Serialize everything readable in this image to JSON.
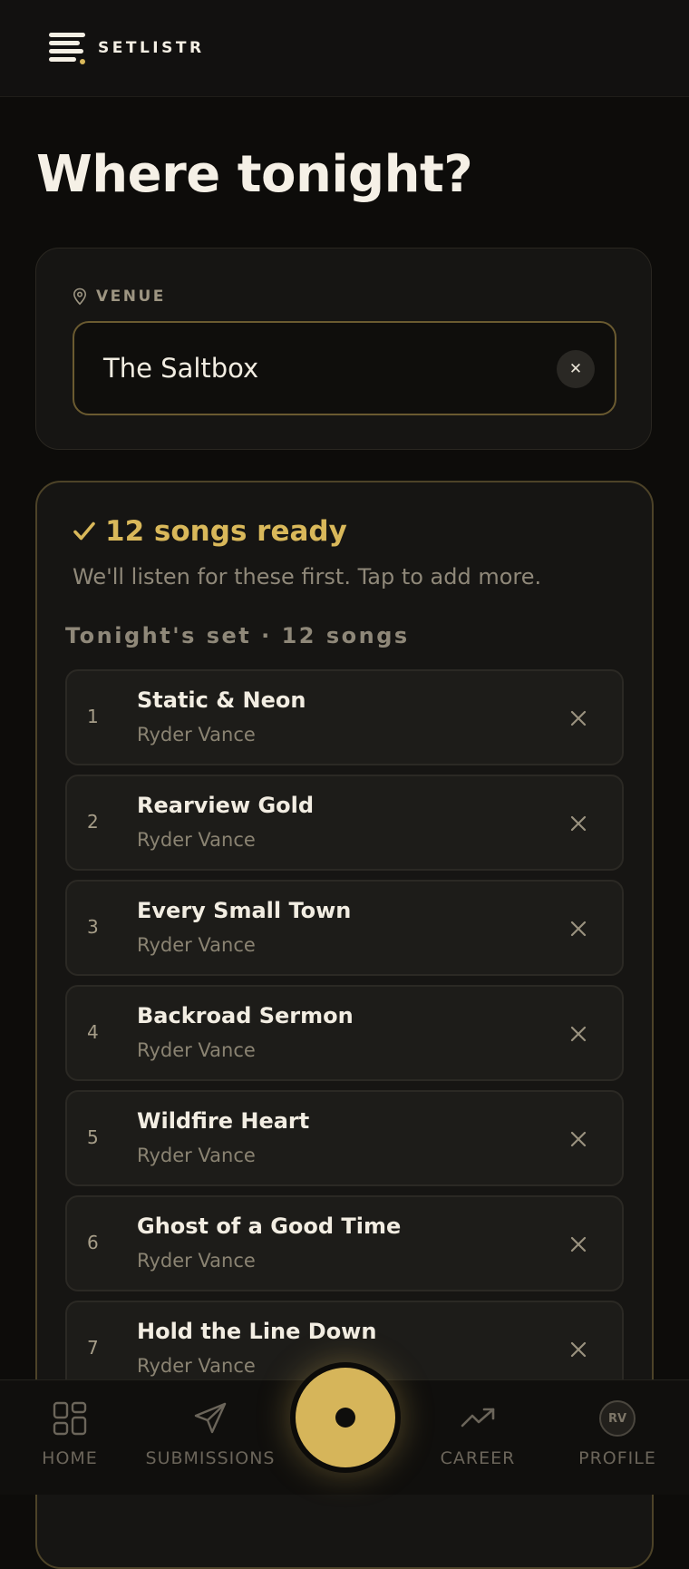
{
  "app": {
    "name": "SETLISTR"
  },
  "page": {
    "title": "Where tonight?"
  },
  "venue": {
    "label": "VENUE",
    "value": "The Saltbox",
    "clear_icon": "close-icon"
  },
  "setlist": {
    "ready_title": "12 songs ready",
    "subtitle": "We'll listen for these first. Tap to add more.",
    "heading": "Tonight's set · 12 songs",
    "songs": [
      {
        "number": "1",
        "title": "Static & Neon",
        "artist": "Ryder Vance"
      },
      {
        "number": "2",
        "title": "Rearview Gold",
        "artist": "Ryder Vance"
      },
      {
        "number": "3",
        "title": "Every Small Town",
        "artist": "Ryder Vance"
      },
      {
        "number": "4",
        "title": "Backroad Sermon",
        "artist": "Ryder Vance"
      },
      {
        "number": "5",
        "title": "Wildfire Heart",
        "artist": "Ryder Vance"
      },
      {
        "number": "6",
        "title": "Ghost of a Good Time",
        "artist": "Ryder Vance"
      },
      {
        "number": "7",
        "title": "Hold the Line Down",
        "artist": "Ryder Vance"
      }
    ]
  },
  "nav": {
    "home": "HOME",
    "submissions": "SUBMISSIONS",
    "career": "CAREER",
    "profile": "PROFILE",
    "avatar_initials": "RV"
  },
  "colors": {
    "accent": "#d9b85a",
    "background": "#0d0c0a",
    "card": "#161513"
  }
}
